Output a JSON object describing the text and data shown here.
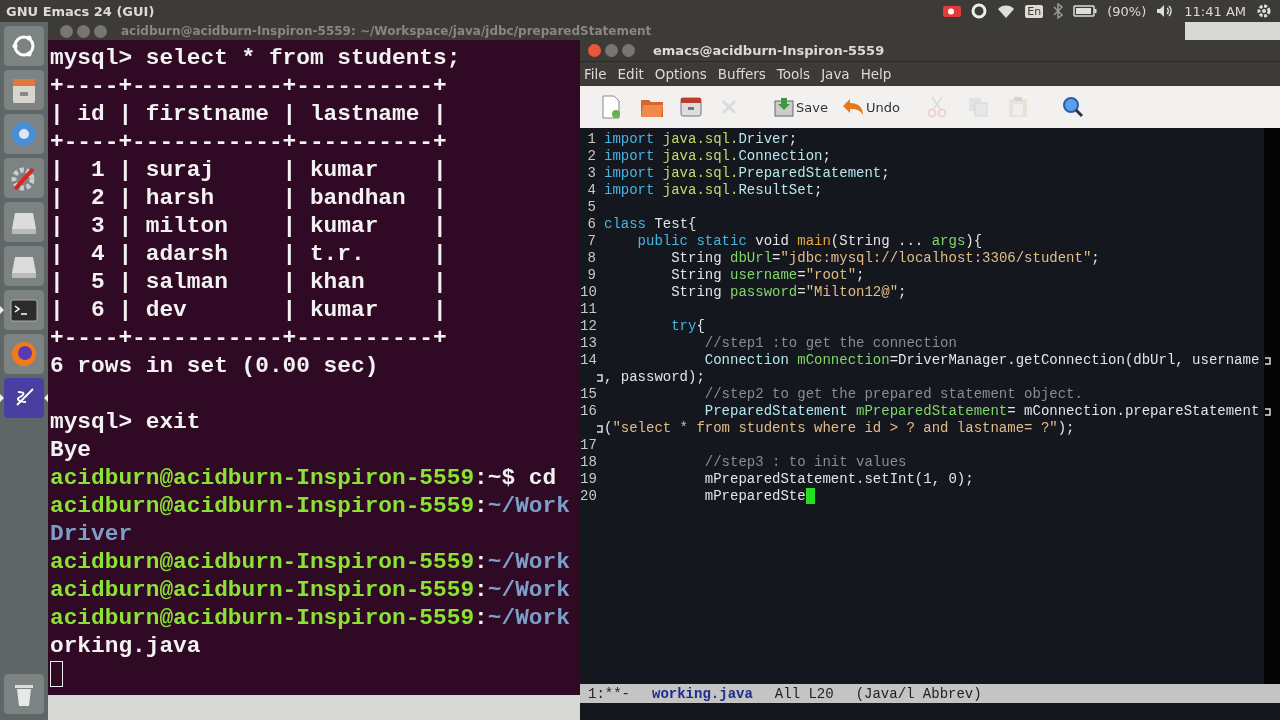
{
  "top_bar": {
    "app_title": "GNU Emacs 24 (GUI)",
    "keyboard": "En",
    "battery": "(90%)",
    "clock": "11:41 AM"
  },
  "launcher": {
    "items": [
      {
        "kind": "dash",
        "running": false,
        "focused": false
      },
      {
        "kind": "files",
        "running": false,
        "focused": false
      },
      {
        "kind": "chromium",
        "running": false,
        "focused": false
      },
      {
        "kind": "settings",
        "running": false,
        "focused": false
      },
      {
        "kind": "drive",
        "running": false,
        "focused": false
      },
      {
        "kind": "drive",
        "running": false,
        "focused": false
      },
      {
        "kind": "terminal",
        "running": true,
        "focused": false
      },
      {
        "kind": "firefox",
        "running": false,
        "focused": false
      },
      {
        "kind": "emacs",
        "running": true,
        "focused": true
      }
    ],
    "trash": {
      "kind": "trash"
    }
  },
  "terminal": {
    "title": "acidburn@acidburn-Inspiron-5559: ~/Workspace/java/jdbc/preparedStatement",
    "lines": [
      {
        "kind": "text",
        "parts": [
          {
            "kind": "plain",
            "text": "mysql> select * from students;"
          }
        ]
      },
      {
        "kind": "text",
        "parts": [
          {
            "kind": "plain",
            "text": "+----+-----------+----------+"
          }
        ]
      },
      {
        "kind": "text",
        "parts": [
          {
            "kind": "plain",
            "text": "| id | firstname | lastname |"
          }
        ]
      },
      {
        "kind": "text",
        "parts": [
          {
            "kind": "plain",
            "text": "+----+-----------+----------+"
          }
        ]
      },
      {
        "kind": "text",
        "parts": [
          {
            "kind": "plain",
            "text": "|  1 | suraj     | kumar    |"
          }
        ]
      },
      {
        "kind": "text",
        "parts": [
          {
            "kind": "plain",
            "text": "|  2 | harsh     | bandhan  |"
          }
        ]
      },
      {
        "kind": "text",
        "parts": [
          {
            "kind": "plain",
            "text": "|  3 | milton    | kumar    |"
          }
        ]
      },
      {
        "kind": "text",
        "parts": [
          {
            "kind": "plain",
            "text": "|  4 | adarsh    | t.r.     |"
          }
        ]
      },
      {
        "kind": "text",
        "parts": [
          {
            "kind": "plain",
            "text": "|  5 | salman    | khan     |"
          }
        ]
      },
      {
        "kind": "text",
        "parts": [
          {
            "kind": "plain",
            "text": "|  6 | dev       | kumar    |"
          }
        ]
      },
      {
        "kind": "text",
        "parts": [
          {
            "kind": "plain",
            "text": "+----+-----------+----------+"
          }
        ]
      },
      {
        "kind": "text",
        "parts": [
          {
            "kind": "plain",
            "text": "6 rows in set (0.00 sec)"
          }
        ]
      },
      {
        "kind": "blank"
      },
      {
        "kind": "text",
        "parts": [
          {
            "kind": "plain",
            "text": "mysql> exit"
          }
        ]
      },
      {
        "kind": "text",
        "parts": [
          {
            "kind": "plain",
            "text": "Bye"
          }
        ]
      },
      {
        "kind": "text",
        "parts": [
          {
            "kind": "host",
            "text": "acidburn@acidburn-Inspiron-5559"
          },
          {
            "kind": "plain",
            "text": ":~$ cd"
          }
        ]
      },
      {
        "kind": "text",
        "parts": [
          {
            "kind": "host",
            "text": "acidburn@acidburn-Inspiron-5559"
          },
          {
            "kind": "plain",
            "text": ":"
          },
          {
            "kind": "path",
            "text": "~/Work"
          }
        ]
      },
      {
        "kind": "text",
        "parts": [
          {
            "kind": "path",
            "text": "Driver"
          }
        ]
      },
      {
        "kind": "text",
        "parts": [
          {
            "kind": "host",
            "text": "acidburn@acidburn-Inspiron-5559"
          },
          {
            "kind": "plain",
            "text": ":"
          },
          {
            "kind": "path",
            "text": "~/Work"
          }
        ]
      },
      {
        "kind": "text",
        "parts": [
          {
            "kind": "host",
            "text": "acidburn@acidburn-Inspiron-5559"
          },
          {
            "kind": "plain",
            "text": ":"
          },
          {
            "kind": "path",
            "text": "~/Work"
          }
        ]
      },
      {
        "kind": "text",
        "parts": [
          {
            "kind": "host",
            "text": "acidburn@acidburn-Inspiron-5559"
          },
          {
            "kind": "plain",
            "text": ":"
          },
          {
            "kind": "path",
            "text": "~/Work"
          }
        ]
      },
      {
        "kind": "text",
        "parts": [
          {
            "kind": "plain",
            "text": "orking.java"
          }
        ]
      },
      {
        "kind": "cursor"
      }
    ]
  },
  "emacs": {
    "title": "emacs@acidburn-Inspiron-5559",
    "menu": [
      "File",
      "Edit",
      "Options",
      "Buffers",
      "Tools",
      "Java",
      "Help"
    ],
    "toolbar": [
      {
        "kind": "new",
        "disabled": false
      },
      {
        "kind": "open",
        "disabled": false
      },
      {
        "kind": "dired",
        "disabled": false
      },
      {
        "kind": "close",
        "disabled": true
      },
      {
        "kind": "save",
        "label": "Save",
        "disabled": false
      },
      {
        "kind": "undo",
        "label": "Undo",
        "disabled": false
      },
      {
        "kind": "cut",
        "disabled": true
      },
      {
        "kind": "copy",
        "disabled": true
      },
      {
        "kind": "paste",
        "disabled": true
      },
      {
        "kind": "search",
        "disabled": false
      }
    ],
    "code": [
      {
        "number": "1",
        "wraps": false,
        "continues": false,
        "tokens": [
          {
            "kind": "kw",
            "text": "import "
          },
          {
            "kind": "pkg",
            "text": "java.sql."
          },
          {
            "kind": "type",
            "text": "Driver"
          },
          {
            "kind": "plain",
            "text": ";"
          }
        ]
      },
      {
        "number": "2",
        "wraps": false,
        "continues": false,
        "tokens": [
          {
            "kind": "kw",
            "text": "import "
          },
          {
            "kind": "pkg",
            "text": "java.sql."
          },
          {
            "kind": "type",
            "text": "Connection"
          },
          {
            "kind": "plain",
            "text": ";"
          }
        ]
      },
      {
        "number": "3",
        "wraps": false,
        "continues": false,
        "tokens": [
          {
            "kind": "kw",
            "text": "import "
          },
          {
            "kind": "pkg",
            "text": "java.sql."
          },
          {
            "kind": "type",
            "text": "PreparedStatement"
          },
          {
            "kind": "plain",
            "text": ";"
          }
        ]
      },
      {
        "number": "4",
        "wraps": false,
        "continues": false,
        "tokens": [
          {
            "kind": "kw",
            "text": "import "
          },
          {
            "kind": "pkg",
            "text": "java.sql."
          },
          {
            "kind": "type",
            "text": "ResultSet"
          },
          {
            "kind": "plain",
            "text": ";"
          }
        ]
      },
      {
        "number": "5",
        "wraps": false,
        "continues": false
      },
      {
        "number": "6",
        "wraps": false,
        "continues": false,
        "tokens": [
          {
            "kind": "kw",
            "text": "class "
          },
          {
            "kind": "plain",
            "text": "Test{"
          }
        ]
      },
      {
        "number": "7",
        "wraps": false,
        "continues": false,
        "tokens": [
          {
            "kind": "kw",
            "text": "    public static "
          },
          {
            "kind": "plain",
            "text": "void "
          },
          {
            "kind": "fn",
            "text": "main"
          },
          {
            "kind": "plain",
            "text": "(String ... "
          },
          {
            "kind": "var",
            "text": "args"
          },
          {
            "kind": "plain",
            "text": "){"
          }
        ]
      },
      {
        "number": "8",
        "wraps": false,
        "continues": false,
        "tokens": [
          {
            "kind": "plain",
            "text": "        String "
          },
          {
            "kind": "var",
            "text": "dbUrl"
          },
          {
            "kind": "plain",
            "text": "="
          },
          {
            "kind": "str",
            "text": "\"jdbc:mysql://localhost:3306/student\""
          },
          {
            "kind": "plain",
            "text": ";"
          }
        ]
      },
      {
        "number": "9",
        "wraps": false,
        "continues": false,
        "tokens": [
          {
            "kind": "plain",
            "text": "        String "
          },
          {
            "kind": "var",
            "text": "username"
          },
          {
            "kind": "plain",
            "text": "="
          },
          {
            "kind": "str",
            "text": "\"root\""
          },
          {
            "kind": "plain",
            "text": ";"
          }
        ]
      },
      {
        "number": "10",
        "wraps": false,
        "continues": false,
        "tokens": [
          {
            "kind": "plain",
            "text": "        String "
          },
          {
            "kind": "var",
            "text": "password"
          },
          {
            "kind": "plain",
            "text": "="
          },
          {
            "kind": "str",
            "text": "\"Milton12@\""
          },
          {
            "kind": "plain",
            "text": ";"
          }
        ]
      },
      {
        "number": "11",
        "wraps": false,
        "continues": false
      },
      {
        "number": "12",
        "wraps": false,
        "continues": false,
        "tokens": [
          {
            "kind": "kw",
            "text": "        try"
          },
          {
            "kind": "plain",
            "text": "{"
          }
        ]
      },
      {
        "number": "13",
        "wraps": false,
        "continues": false,
        "tokens": [
          {
            "kind": "comment",
            "text": "            //step1 :to get the connection"
          }
        ]
      },
      {
        "number": "14",
        "wraps": true,
        "continues": false,
        "tokens": [
          {
            "kind": "type",
            "text": "            Connection "
          },
          {
            "kind": "var",
            "text": "mConnection"
          },
          {
            "kind": "plain",
            "text": "=DriverManager.getConnection(dbUrl, username"
          }
        ]
      },
      {
        "wraps": false,
        "continues": true,
        "tokens": [
          {
            "kind": "plain",
            "text": ", password);"
          }
        ]
      },
      {
        "number": "15",
        "wraps": false,
        "continues": false,
        "tokens": [
          {
            "kind": "comment",
            "text": "            //step2 to get the prepared statement object."
          }
        ]
      },
      {
        "number": "16",
        "wraps": true,
        "continues": false,
        "tokens": [
          {
            "kind": "type",
            "text": "            PreparedStatement "
          },
          {
            "kind": "var",
            "text": "mPreparedStatement"
          },
          {
            "kind": "plain",
            "text": "= mConnection.prepareStatement"
          }
        ]
      },
      {
        "wraps": false,
        "continues": true,
        "tokens": [
          {
            "kind": "plain",
            "text": "("
          },
          {
            "kind": "str",
            "text": "\"select * from students where id > ? and lastname= ?\""
          },
          {
            "kind": "plain",
            "text": ");"
          }
        ]
      },
      {
        "number": "17",
        "wraps": false,
        "continues": false
      },
      {
        "number": "18",
        "wraps": false,
        "continues": false,
        "tokens": [
          {
            "kind": "comment",
            "text": "            //step3 : to init values"
          }
        ]
      },
      {
        "number": "19",
        "wraps": false,
        "continues": false,
        "tokens": [
          {
            "kind": "plain",
            "text": "            mPreparedStatement.setInt(1, 0);"
          }
        ]
      },
      {
        "number": "20",
        "wraps": false,
        "continues": false,
        "tokens": [
          {
            "kind": "plain",
            "text": "            mPreparedSte"
          },
          {
            "kind": "cursor"
          }
        ]
      }
    ],
    "mode_line": {
      "status": "1:**-",
      "buffer": "working.java",
      "position": "All L20",
      "modes": "(Java/l Abbrev)"
    }
  }
}
